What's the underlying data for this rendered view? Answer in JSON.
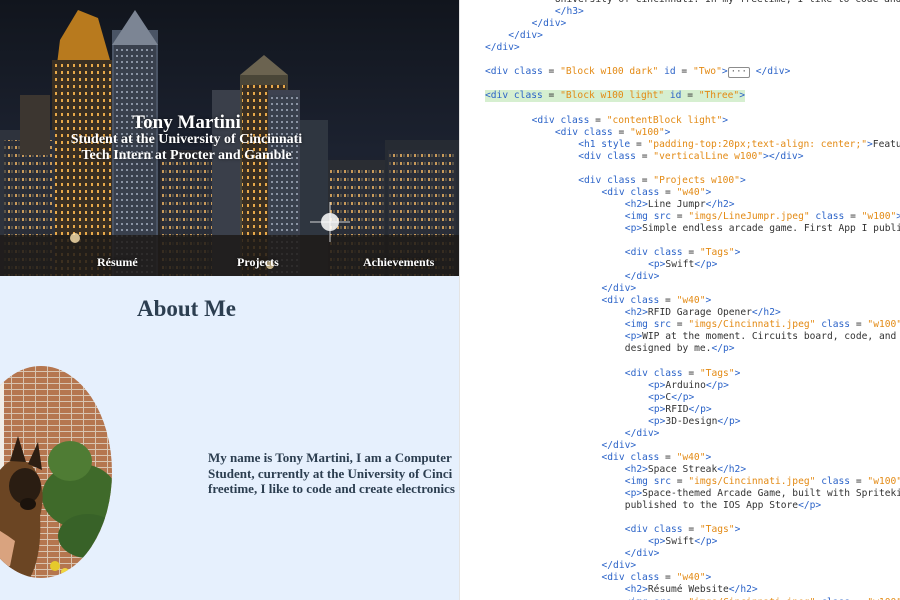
{
  "preview": {
    "hero": {
      "name": "Tony Martini",
      "line1": "Student at the University of Cincinnati",
      "line2": "Tech Intern at Procter and Gamble"
    },
    "nav": [
      {
        "label": "Résumé"
      },
      {
        "label": "Projects"
      },
      {
        "label": "Achievements"
      }
    ],
    "about": {
      "title": "About Me",
      "text_lines": [
        "My name is Tony Martini, I am a Computer",
        "Student, currently at the University of Cinci",
        "freetime, I like to code and create electronics"
      ]
    }
  },
  "editor": {
    "lines": [
      {
        "indent": 3,
        "parts": [
          [
            "x",
            "University of Cincinnati. In my freetime, I like to code and"
          ]
        ]
      },
      {
        "indent": 3,
        "parts": [
          [
            "t",
            "</h3>"
          ]
        ]
      },
      {
        "indent": 2,
        "parts": [
          [
            "t",
            "</div>"
          ]
        ]
      },
      {
        "indent": 1,
        "parts": [
          [
            "t",
            "</div>"
          ]
        ]
      },
      {
        "indent": 0,
        "parts": [
          [
            "t",
            "</div>"
          ]
        ]
      },
      {
        "indent": 0,
        "parts": []
      },
      {
        "indent": 0,
        "parts": [
          [
            "t",
            "<div"
          ],
          [
            "x",
            " "
          ],
          [
            "a",
            "class"
          ],
          [
            "x",
            " = "
          ],
          [
            "s",
            "\"Block w100 dark\""
          ],
          [
            "x",
            " "
          ],
          [
            "a",
            "id"
          ],
          [
            "x",
            " = "
          ],
          [
            "s",
            "\"Two\""
          ],
          [
            "t",
            ">"
          ],
          [
            "fold",
            "···"
          ],
          [
            "x",
            " "
          ],
          [
            "t",
            "</div>"
          ]
        ]
      },
      {
        "indent": 0,
        "parts": []
      },
      {
        "indent": 0,
        "highlight": true,
        "parts": [
          [
            "t",
            "<div"
          ],
          [
            "x",
            " "
          ],
          [
            "a",
            "class"
          ],
          [
            "x",
            " = "
          ],
          [
            "s",
            "\"Block w100 light\""
          ],
          [
            "x",
            " "
          ],
          [
            "a",
            "id"
          ],
          [
            "x",
            " = "
          ],
          [
            "s",
            "\"Three\""
          ],
          [
            "t",
            ">"
          ]
        ]
      },
      {
        "indent": 0,
        "parts": []
      },
      {
        "indent": 2,
        "parts": [
          [
            "t",
            "<div"
          ],
          [
            "x",
            " "
          ],
          [
            "a",
            "class"
          ],
          [
            "x",
            " = "
          ],
          [
            "s",
            "\"contentBlock light\""
          ],
          [
            "t",
            ">"
          ]
        ]
      },
      {
        "indent": 3,
        "parts": [
          [
            "t",
            "<div"
          ],
          [
            "x",
            " "
          ],
          [
            "a",
            "class"
          ],
          [
            "x",
            " = "
          ],
          [
            "s",
            "\"w100\""
          ],
          [
            "t",
            ">"
          ]
        ]
      },
      {
        "indent": 4,
        "parts": [
          [
            "t",
            "<h1"
          ],
          [
            "x",
            " "
          ],
          [
            "a",
            "style"
          ],
          [
            "x",
            " = "
          ],
          [
            "s",
            "\"padding-top:20px;text-align: center;\""
          ],
          [
            "t",
            ">"
          ],
          [
            "x",
            "Featu"
          ]
        ]
      },
      {
        "indent": 4,
        "parts": [
          [
            "t",
            "<div"
          ],
          [
            "x",
            " "
          ],
          [
            "a",
            "class"
          ],
          [
            "x",
            " = "
          ],
          [
            "s",
            "\"verticalLine w100\""
          ],
          [
            "t",
            "></div>"
          ]
        ]
      },
      {
        "indent": 0,
        "parts": []
      },
      {
        "indent": 4,
        "parts": [
          [
            "t",
            "<div"
          ],
          [
            "x",
            " "
          ],
          [
            "a",
            "class"
          ],
          [
            "x",
            " = "
          ],
          [
            "s",
            "\"Projects w100\""
          ],
          [
            "t",
            ">"
          ]
        ]
      },
      {
        "indent": 5,
        "parts": [
          [
            "t",
            "<div"
          ],
          [
            "x",
            " "
          ],
          [
            "a",
            "class"
          ],
          [
            "x",
            " = "
          ],
          [
            "s",
            "\"w40\""
          ],
          [
            "t",
            ">"
          ]
        ]
      },
      {
        "indent": 6,
        "parts": [
          [
            "t",
            "<h2>"
          ],
          [
            "x",
            "Line Jumpr"
          ],
          [
            "t",
            "</h2>"
          ]
        ]
      },
      {
        "indent": 6,
        "parts": [
          [
            "t",
            "<img"
          ],
          [
            "x",
            " "
          ],
          [
            "a",
            "src"
          ],
          [
            "x",
            " = "
          ],
          [
            "s",
            "\"imgs/LineJumpr.jpeg\""
          ],
          [
            "x",
            " "
          ],
          [
            "a",
            "class"
          ],
          [
            "x",
            " = "
          ],
          [
            "s",
            "\"w100\""
          ],
          [
            "t",
            ">"
          ]
        ]
      },
      {
        "indent": 6,
        "parts": [
          [
            "t",
            "<p>"
          ],
          [
            "x",
            "Simple endless arcade game. First App I publi"
          ]
        ]
      },
      {
        "indent": 0,
        "parts": []
      },
      {
        "indent": 6,
        "parts": [
          [
            "t",
            "<div"
          ],
          [
            "x",
            " "
          ],
          [
            "a",
            "class"
          ],
          [
            "x",
            " = "
          ],
          [
            "s",
            "\"Tags\""
          ],
          [
            "t",
            ">"
          ]
        ]
      },
      {
        "indent": 7,
        "parts": [
          [
            "t",
            "<p>"
          ],
          [
            "x",
            "Swift"
          ],
          [
            "t",
            "</p>"
          ]
        ]
      },
      {
        "indent": 6,
        "parts": [
          [
            "t",
            "</div>"
          ]
        ]
      },
      {
        "indent": 5,
        "parts": [
          [
            "t",
            "</div>"
          ]
        ]
      },
      {
        "indent": 5,
        "parts": [
          [
            "t",
            "<div"
          ],
          [
            "x",
            " "
          ],
          [
            "a",
            "class"
          ],
          [
            "x",
            " = "
          ],
          [
            "s",
            "\"w40\""
          ],
          [
            "t",
            ">"
          ]
        ]
      },
      {
        "indent": 6,
        "parts": [
          [
            "t",
            "<h2>"
          ],
          [
            "x",
            "RFID Garage Opener"
          ],
          [
            "t",
            "</h2>"
          ]
        ]
      },
      {
        "indent": 6,
        "parts": [
          [
            "t",
            "<img"
          ],
          [
            "x",
            " "
          ],
          [
            "a",
            "src"
          ],
          [
            "x",
            " = "
          ],
          [
            "s",
            "\"imgs/Cincinnati.jpeg\""
          ],
          [
            "x",
            " "
          ],
          [
            "a",
            "class"
          ],
          [
            "x",
            " = "
          ],
          [
            "s",
            "\"w100\""
          ]
        ]
      },
      {
        "indent": 6,
        "parts": [
          [
            "t",
            "<p>"
          ],
          [
            "x",
            "WIP at the moment. Circuits board, code, and"
          ]
        ]
      },
      {
        "indent": 6,
        "parts": [
          [
            "x",
            "designed by me."
          ],
          [
            "t",
            "</p>"
          ]
        ]
      },
      {
        "indent": 0,
        "parts": []
      },
      {
        "indent": 6,
        "parts": [
          [
            "t",
            "<div"
          ],
          [
            "x",
            " "
          ],
          [
            "a",
            "class"
          ],
          [
            "x",
            " = "
          ],
          [
            "s",
            "\"Tags\""
          ],
          [
            "t",
            ">"
          ]
        ]
      },
      {
        "indent": 7,
        "parts": [
          [
            "t",
            "<p>"
          ],
          [
            "x",
            "Arduino"
          ],
          [
            "t",
            "</p>"
          ]
        ]
      },
      {
        "indent": 7,
        "parts": [
          [
            "t",
            "<p>"
          ],
          [
            "x",
            "C"
          ],
          [
            "t",
            "</p>"
          ]
        ]
      },
      {
        "indent": 7,
        "parts": [
          [
            "t",
            "<p>"
          ],
          [
            "x",
            "RFID"
          ],
          [
            "t",
            "</p>"
          ]
        ]
      },
      {
        "indent": 7,
        "parts": [
          [
            "t",
            "<p>"
          ],
          [
            "x",
            "3D-Design"
          ],
          [
            "t",
            "</p>"
          ]
        ]
      },
      {
        "indent": 6,
        "parts": [
          [
            "t",
            "</div>"
          ]
        ]
      },
      {
        "indent": 5,
        "parts": [
          [
            "t",
            "</div>"
          ]
        ]
      },
      {
        "indent": 5,
        "parts": [
          [
            "t",
            "<div"
          ],
          [
            "x",
            " "
          ],
          [
            "a",
            "class"
          ],
          [
            "x",
            " = "
          ],
          [
            "s",
            "\"w40\""
          ],
          [
            "t",
            ">"
          ]
        ]
      },
      {
        "indent": 6,
        "parts": [
          [
            "t",
            "<h2>"
          ],
          [
            "x",
            "Space Streak"
          ],
          [
            "t",
            "</h2>"
          ]
        ]
      },
      {
        "indent": 6,
        "parts": [
          [
            "t",
            "<img"
          ],
          [
            "x",
            " "
          ],
          [
            "a",
            "src"
          ],
          [
            "x",
            " = "
          ],
          [
            "s",
            "\"imgs/Cincinnati.jpeg\""
          ],
          [
            "x",
            " "
          ],
          [
            "a",
            "class"
          ],
          [
            "x",
            " = "
          ],
          [
            "s",
            "\"w100\""
          ]
        ]
      },
      {
        "indent": 6,
        "parts": [
          [
            "t",
            "<p>"
          ],
          [
            "x",
            "Space-themed Arcade Game, built with Spriteki"
          ]
        ]
      },
      {
        "indent": 6,
        "parts": [
          [
            "x",
            "published to the IOS App Store"
          ],
          [
            "t",
            "</p>"
          ]
        ]
      },
      {
        "indent": 0,
        "parts": []
      },
      {
        "indent": 6,
        "parts": [
          [
            "t",
            "<div"
          ],
          [
            "x",
            " "
          ],
          [
            "a",
            "class"
          ],
          [
            "x",
            " = "
          ],
          [
            "s",
            "\"Tags\""
          ],
          [
            "t",
            ">"
          ]
        ]
      },
      {
        "indent": 7,
        "parts": [
          [
            "t",
            "<p>"
          ],
          [
            "x",
            "Swift"
          ],
          [
            "t",
            "</p>"
          ]
        ]
      },
      {
        "indent": 6,
        "parts": [
          [
            "t",
            "</div>"
          ]
        ]
      },
      {
        "indent": 5,
        "parts": [
          [
            "t",
            "</div>"
          ]
        ]
      },
      {
        "indent": 5,
        "parts": [
          [
            "t",
            "<div"
          ],
          [
            "x",
            " "
          ],
          [
            "a",
            "class"
          ],
          [
            "x",
            " = "
          ],
          [
            "s",
            "\"w40\""
          ],
          [
            "t",
            ">"
          ]
        ]
      },
      {
        "indent": 6,
        "parts": [
          [
            "t",
            "<h2>"
          ],
          [
            "x",
            "Résumé Website"
          ],
          [
            "t",
            "</h2>"
          ]
        ]
      },
      {
        "indent": 6,
        "parts": [
          [
            "t",
            "<img"
          ],
          [
            "x",
            " "
          ],
          [
            "a",
            "src"
          ],
          [
            "x",
            " = "
          ],
          [
            "s",
            "\"imgs/Cincinnati.jpeg\""
          ],
          [
            "x",
            " "
          ],
          [
            "a",
            "class"
          ],
          [
            "x",
            " = "
          ],
          [
            "s",
            "\"w100\""
          ]
        ]
      }
    ]
  }
}
